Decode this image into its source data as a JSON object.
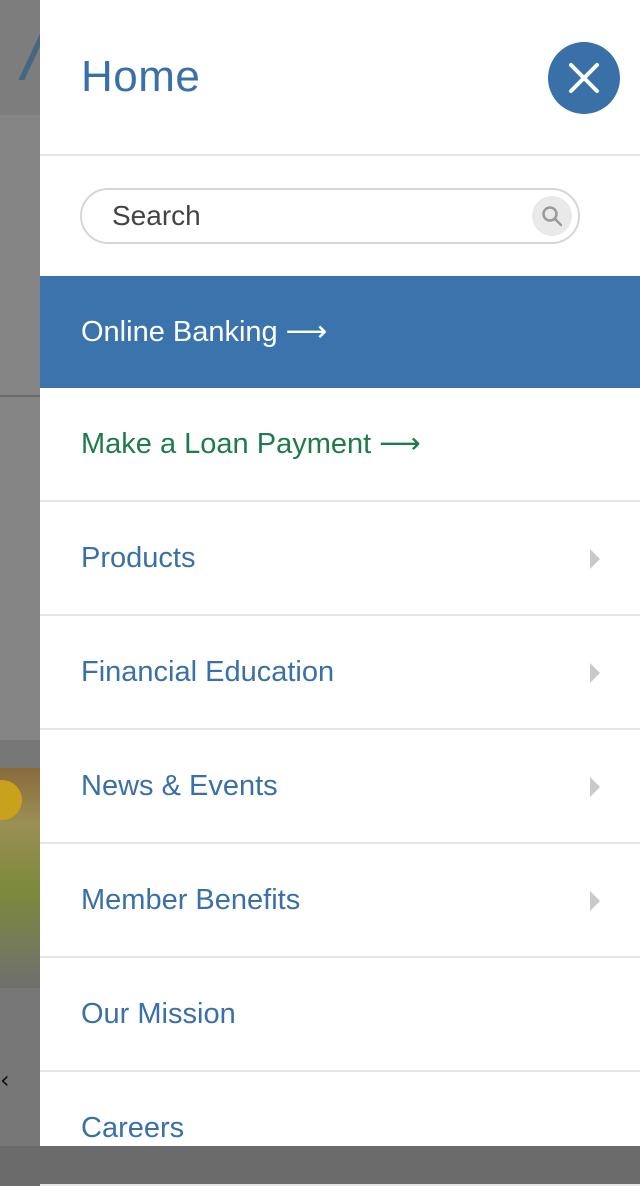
{
  "drawer": {
    "title": "Home",
    "close_icon": "close-icon",
    "accent_color": "#3a70a8"
  },
  "search": {
    "placeholder": "Search",
    "value": "",
    "icon": "search-icon"
  },
  "menu": {
    "items": [
      {
        "label": "Online Banking ⟶",
        "style": "primary",
        "has_submenu": false
      },
      {
        "label": "Make a Loan Payment ⟶",
        "style": "loan",
        "has_submenu": false
      },
      {
        "label": "Products",
        "style": "normal",
        "has_submenu": true
      },
      {
        "label": "Financial Education",
        "style": "normal",
        "has_submenu": true
      },
      {
        "label": "News & Events",
        "style": "normal",
        "has_submenu": true
      },
      {
        "label": "Member Benefits",
        "style": "normal",
        "has_submenu": true
      },
      {
        "label": "Our Mission",
        "style": "normal",
        "has_submenu": false
      },
      {
        "label": "Careers",
        "style": "normal",
        "has_submenu": false
      }
    ]
  },
  "background_page": {
    "carousel_prev_icon": "chevron-left-icon"
  },
  "colors": {
    "primary_blue": "#3b73ad",
    "loan_green": "#1f7a4c",
    "text_blue": "#3a70a8"
  }
}
